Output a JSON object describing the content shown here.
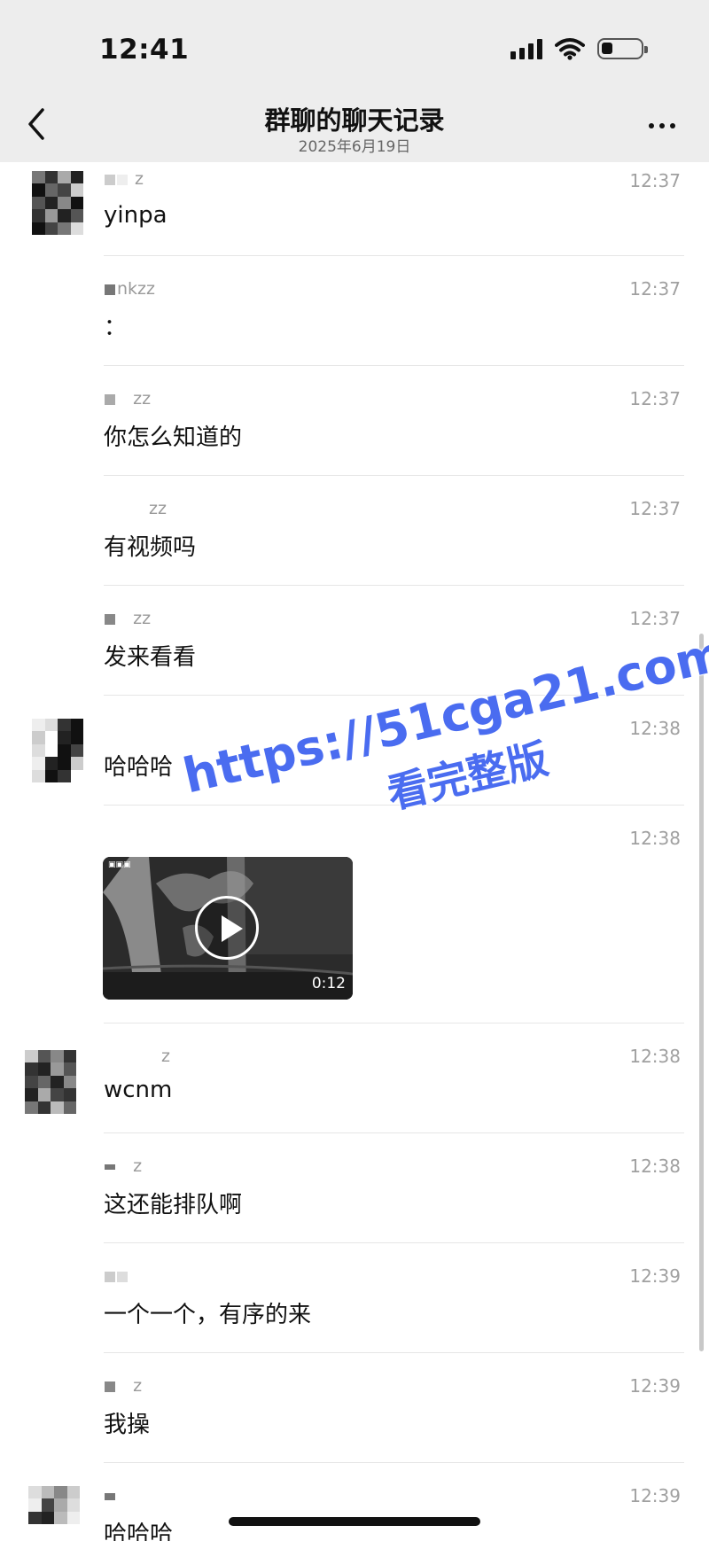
{
  "status": {
    "time": "12:41"
  },
  "nav": {
    "title": "群聊的聊天记录",
    "subtitle": "2025年6月19日"
  },
  "watermark": {
    "url": "https://51cga21.com",
    "caption": "看完整版",
    "color": "#4a6cf0"
  },
  "messages": [
    {
      "sender": "z",
      "time": "12:37",
      "text": "yinpa"
    },
    {
      "sender": "nkzz",
      "time": "12:37",
      "text": "："
    },
    {
      "sender": "zz",
      "time": "12:37",
      "text": "你怎么知道的"
    },
    {
      "sender": "zz",
      "time": "12:37",
      "text": "有视频吗"
    },
    {
      "sender": "zz",
      "time": "12:37",
      "text": "发来看看"
    },
    {
      "sender": "",
      "time": "12:38",
      "text": "哈哈哈"
    },
    {
      "sender": "",
      "time": "12:38",
      "video_duration": "0:12",
      "video_icon": "play-icon"
    },
    {
      "sender": "z",
      "time": "12:38",
      "text": "wcnm"
    },
    {
      "sender": "z",
      "time": "12:38",
      "text": "这还能排队啊"
    },
    {
      "sender": "",
      "time": "12:39",
      "text": "一个一个，有序的来"
    },
    {
      "sender": "z",
      "time": "12:39",
      "text": "我操"
    },
    {
      "sender": "",
      "time": "12:39",
      "text": "哈哈哈"
    }
  ]
}
